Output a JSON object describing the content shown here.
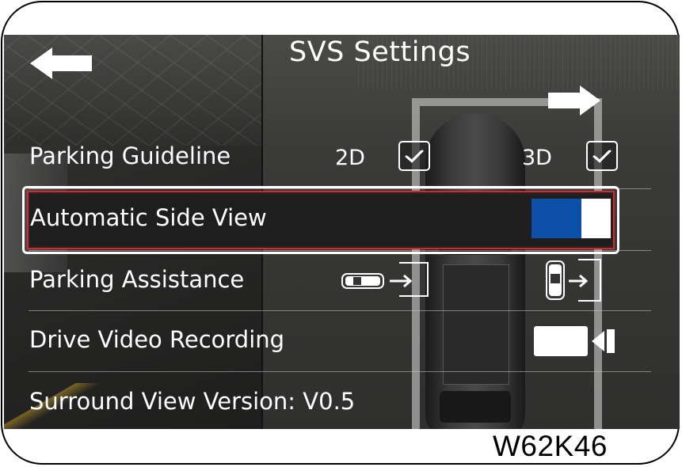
{
  "header": {
    "title": "SVS Settings"
  },
  "rows": {
    "parking_guideline": {
      "label": "Parking Guideline",
      "option_2d": "2D",
      "option_3d": "3D"
    },
    "automatic_side_view": {
      "label": "Automatic Side View",
      "toggle_color": "#0b4fa8"
    },
    "parking_assistance": {
      "label": "Parking Assistance"
    },
    "drive_video_recording": {
      "label": "Drive Video Recording"
    },
    "version": {
      "label": "Surround View Version: V0.5"
    }
  },
  "icons": {
    "back": "back-arrow-icon",
    "forward": "forward-arrow-icon",
    "check": "checkmark-icon",
    "car_parallel": "car-parallel-parking-icon",
    "car_perpendicular": "car-perpendicular-parking-icon",
    "record": "video-record-icon"
  },
  "figure_code": "W62K46"
}
